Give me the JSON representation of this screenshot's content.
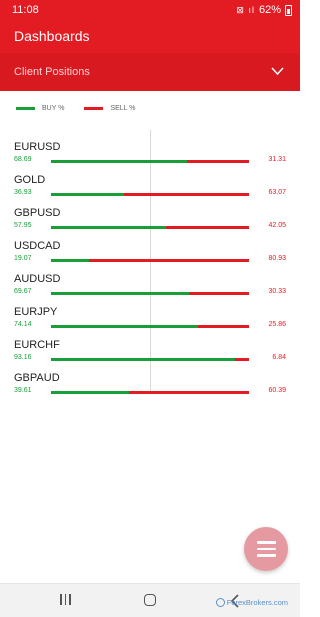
{
  "status_bar": {
    "time": "11:08",
    "icons": "⊠ ıl",
    "battery": "62%"
  },
  "header": {
    "title": "Dashboards"
  },
  "section": {
    "title": "Client Positions"
  },
  "legend": {
    "buy_label": "BUY %",
    "sell_label": "SELL %",
    "buy_color": "#1a9e3a",
    "sell_color": "#e31b23"
  },
  "positions": [
    {
      "pair": "EURUSD",
      "buy": "68.69",
      "sell": "31.31",
      "buy_pct": 68.69
    },
    {
      "pair": "GOLD",
      "buy": "36.93",
      "sell": "63.07",
      "buy_pct": 36.93
    },
    {
      "pair": "GBPUSD",
      "buy": "57.95",
      "sell": "42.05",
      "buy_pct": 57.95
    },
    {
      "pair": "USDCAD",
      "buy": "19.07",
      "sell": "80.93",
      "buy_pct": 19.07
    },
    {
      "pair": "AUDUSD",
      "buy": "69.67",
      "sell": "30.33",
      "buy_pct": 69.67
    },
    {
      "pair": "EURJPY",
      "buy": "74.14",
      "sell": "25.86",
      "buy_pct": 74.14
    },
    {
      "pair": "EURCHF",
      "buy": "93.16",
      "sell": "6.84",
      "buy_pct": 93.16
    },
    {
      "pair": "GBPAUD",
      "buy": "39.61",
      "sell": "60.39",
      "buy_pct": 39.61
    }
  ],
  "watermark": {
    "text": "ForexBrokers.com"
  }
}
